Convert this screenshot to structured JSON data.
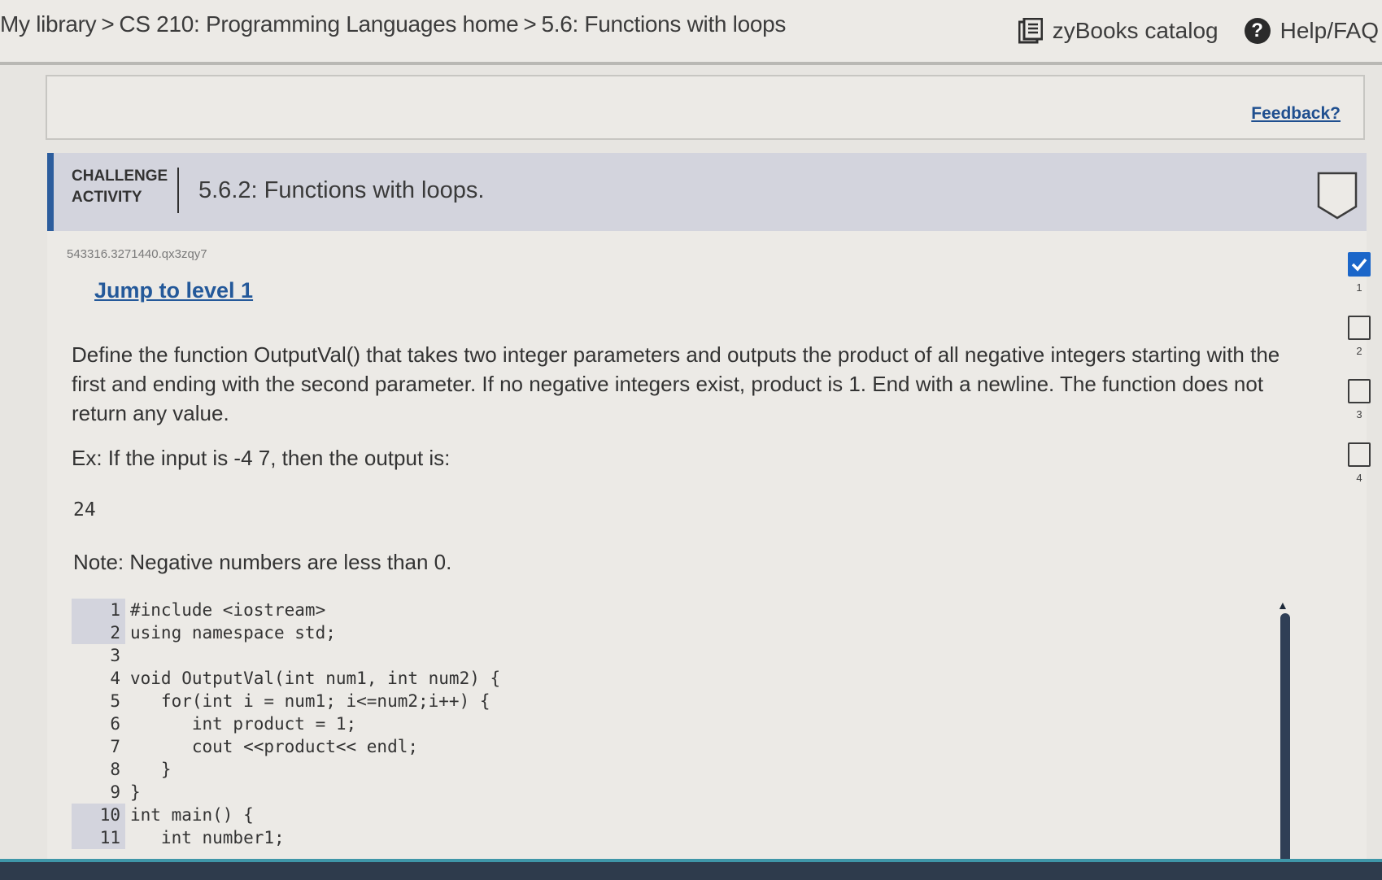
{
  "nav": {
    "breadcrumb": [
      {
        "label": "My library"
      },
      {
        "label": "CS 210: Programming Languages home"
      },
      {
        "label": "5.6: Functions with loops"
      }
    ],
    "separator": ">",
    "catalog_label": "zyBooks catalog",
    "help_label": "Help/FAQ"
  },
  "feedback": {
    "label": "Feedback?"
  },
  "challenge": {
    "label_line1": "CHALLENGE",
    "label_line2": "ACTIVITY",
    "title": "5.6.2: Functions with loops."
  },
  "activity": {
    "id": "543316.3271440.qx3zqy7",
    "jump_label": "Jump to level 1",
    "prompt": "Define the function OutputVal() that takes two integer parameters and outputs the product of all negative integers starting with the first and ending with the second parameter. If no negative integers exist, product is 1. End with a newline. The function does not return any value.",
    "example_label": "Ex: If the input is -4 7, then the output is:",
    "example_output": "24",
    "note": "Note: Negative numbers are less than 0."
  },
  "code": {
    "lines": [
      {
        "num": "1",
        "text": "#include <iostream>",
        "shaded": true
      },
      {
        "num": "2",
        "text": "using namespace std;",
        "shaded": true
      },
      {
        "num": "3",
        "text": "",
        "shaded": false
      },
      {
        "num": "4",
        "text": "void OutputVal(int num1, int num2) {",
        "shaded": false
      },
      {
        "num": "5",
        "text": "   for(int i = num1; i<=num2;i++) {",
        "shaded": false
      },
      {
        "num": "6",
        "text": "      int product = 1;",
        "shaded": false
      },
      {
        "num": "7",
        "text": "      cout <<product<< endl;",
        "shaded": false
      },
      {
        "num": "8",
        "text": "   }",
        "shaded": false
      },
      {
        "num": "9",
        "text": "}",
        "shaded": false
      },
      {
        "num": "10",
        "text": "int main() {",
        "shaded": true
      },
      {
        "num": "11",
        "text": "   int number1;",
        "shaded": true
      }
    ]
  },
  "levels": [
    {
      "num": "1",
      "completed": true
    },
    {
      "num": "2",
      "completed": false
    },
    {
      "num": "3",
      "completed": false
    },
    {
      "num": "4",
      "completed": false
    }
  ],
  "colors": {
    "accent": "#2c5d9d",
    "link": "#24599a",
    "completed": "#1b66c9"
  },
  "icons": {
    "catalog": "catalog-book-icon",
    "help": "help-question-icon",
    "badge": "shield-badge-icon",
    "check": "checkmark-icon",
    "scroll_up": "scroll-up-arrow-icon"
  }
}
